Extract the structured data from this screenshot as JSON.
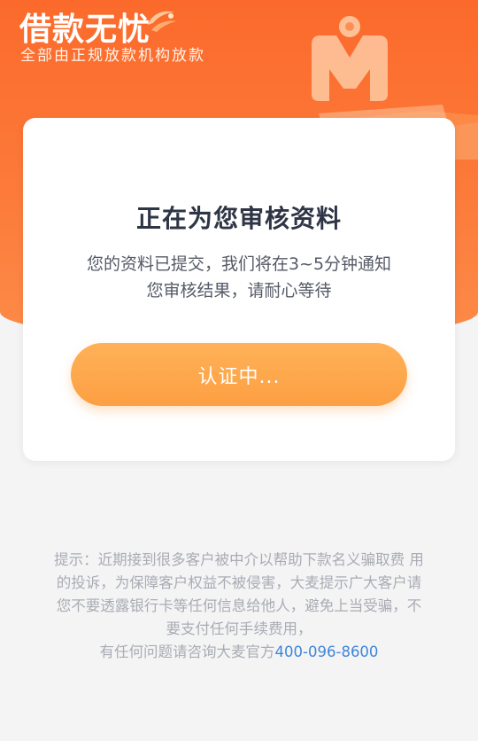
{
  "header": {
    "brand_title": "借款无忧",
    "brand_subtitle": "全部由正规放款机构放款",
    "colors": {
      "primary": "#fb6a2b",
      "primary_light": "#fd8b47"
    }
  },
  "card": {
    "title": "正在为您审核资料",
    "description_line1": "您的资料已提交，我们将在3~5分钟通知",
    "description_line2": "您审核结果，请耐心等待",
    "button_label": "认证中...",
    "colors": {
      "button": "#fd9f42",
      "title": "#2e3545"
    }
  },
  "notice": {
    "line1": "提示：近期接到很多客户被中介以帮助下款名义骗取费 用",
    "line2": "的投诉，为保障客户权益不被侵害，大麦提示广大客户请",
    "line3": "您不要透露银行卡等任何信息给他人，避免上当受骗，不",
    "line4": "要支付任何手续费用，",
    "line5_prefix": "有任何问题请咨询大麦官方",
    "hotline": "400-096-8600",
    "colors": {
      "text": "#a9acb3",
      "hotline": "#3f86d8"
    }
  },
  "icons": {
    "brand_swoosh": "swoosh-icon",
    "header_mascot": "m-logo-illustration"
  }
}
